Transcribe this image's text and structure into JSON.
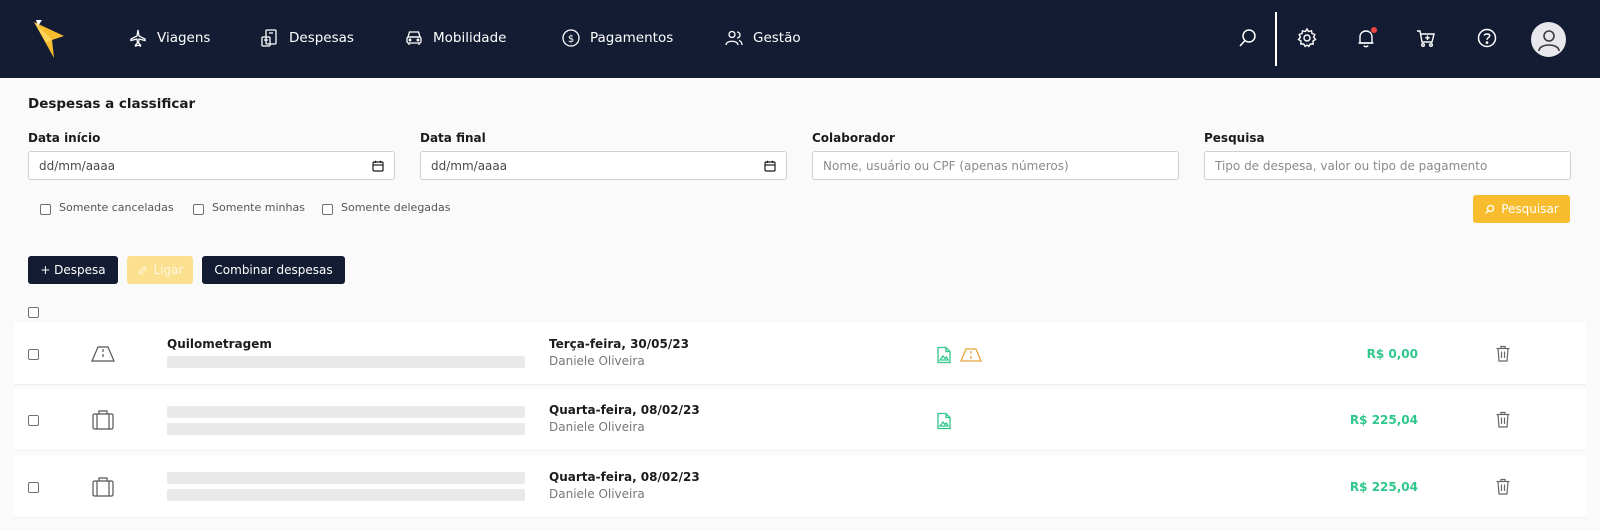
{
  "header": {
    "nav": [
      {
        "label": "Viagens",
        "icon": "plane-icon"
      },
      {
        "label": "Despesas",
        "icon": "receipt-icon"
      },
      {
        "label": "Mobilidade",
        "icon": "car-icon"
      },
      {
        "label": "Pagamentos",
        "icon": "dollar-circle-icon"
      },
      {
        "label": "Gestão",
        "icon": "users-icon"
      }
    ],
    "icons": [
      "search-icon",
      "gear-icon",
      "bell-icon",
      "cart-icon",
      "help-icon",
      "avatar-icon"
    ],
    "colors": {
      "background": "#141c33",
      "brand": "#f7bd2f",
      "notification": "#ef4444"
    }
  },
  "page": {
    "title": "Despesas a classificar"
  },
  "filters": {
    "start_date": {
      "label": "Data início",
      "placeholder": "dd/mm/aaaa"
    },
    "end_date": {
      "label": "Data final",
      "placeholder": "dd/mm/aaaa"
    },
    "collaborator": {
      "label": "Colaborador",
      "placeholder": "Nome, usuário ou CPF (apenas números)"
    },
    "search": {
      "label": "Pesquisa",
      "placeholder": "Tipo de despesa, valor ou tipo de pagamento"
    },
    "checkboxes": [
      {
        "label": "Somente canceladas",
        "checked": false
      },
      {
        "label": "Somente minhas",
        "checked": false
      },
      {
        "label": "Somente delegadas",
        "checked": false
      }
    ],
    "search_button": "Pesquisar"
  },
  "actions": {
    "add_expense": "+ Despesa",
    "link": "Ligar",
    "combine": "Combinar despesas"
  },
  "expenses": [
    {
      "title": "Quilometragem",
      "icon": "road-icon",
      "date": "Terça-feira, 30/05/23",
      "person": "Daniele Oliveira",
      "amount": "R$ 0,00",
      "attachments": [
        "image-file-icon",
        "map-icon"
      ]
    },
    {
      "title": "",
      "icon": "suitcase-icon",
      "date": "Quarta-feira, 08/02/23",
      "person": "Daniele Oliveira",
      "amount": "R$ 225,04",
      "attachments": [
        "image-file-icon"
      ]
    },
    {
      "title": "",
      "icon": "suitcase-icon",
      "date": "Quarta-feira, 08/02/23",
      "person": "Daniele Oliveira",
      "amount": "R$ 225,04",
      "attachments": []
    }
  ],
  "colors": {
    "amount": "#2fc78b",
    "attachment_green": "#2fc78b",
    "attachment_orange": "#e8a33d"
  }
}
